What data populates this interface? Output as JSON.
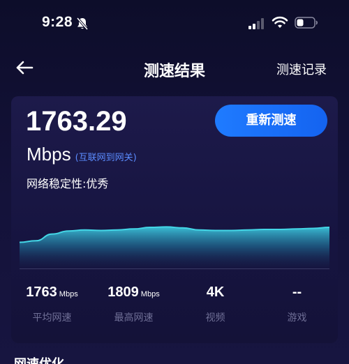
{
  "status_bar": {
    "time": "9:28"
  },
  "nav": {
    "title": "测速结果",
    "history": "测速记录"
  },
  "result": {
    "speed": "1763.29",
    "unit": "Mbps",
    "unit_note": "(互联网到网关)",
    "stability": "网络稳定性:优秀",
    "retest_label": "重新测速"
  },
  "chart_data": {
    "type": "area",
    "y": [
      0.52,
      0.55,
      0.68,
      0.74,
      0.76,
      0.75,
      0.76,
      0.78,
      0.81,
      0.82,
      0.8,
      0.76,
      0.75,
      0.75,
      0.76,
      0.77,
      0.77,
      0.78,
      0.79,
      0.81
    ]
  },
  "stats": [
    {
      "value": "1763",
      "unit": "Mbps",
      "label": "平均网速"
    },
    {
      "value": "1809",
      "unit": "Mbps",
      "label": "最高网速"
    },
    {
      "value": "4K",
      "unit": "",
      "label": "视频"
    },
    {
      "value": "--",
      "unit": "",
      "label": "游戏"
    }
  ],
  "section": {
    "title": "网速优化"
  },
  "colors": {
    "accent": "#1f7bff",
    "chart_line": "#44d6e6",
    "label_gray": "#6f6f96"
  }
}
